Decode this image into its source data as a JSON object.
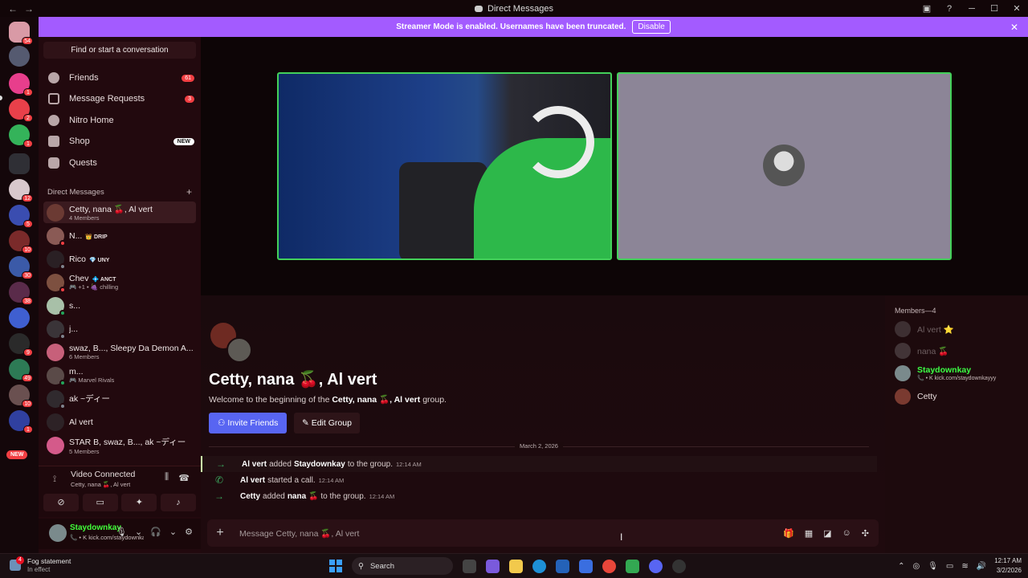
{
  "window": {
    "title": "Direct Messages",
    "back": "←",
    "forward": "→"
  },
  "banner": {
    "text": "Streamer Mode is enabled. Usernames have been truncated.",
    "button": "Disable"
  },
  "server_rail": {
    "badges": [
      "54",
      "1",
      "2",
      "1",
      "12",
      "5",
      "10",
      "30",
      "38",
      "9",
      "49",
      "10",
      "1"
    ],
    "new_label": "NEW"
  },
  "sidebar": {
    "search_placeholder": "Find or start a conversation",
    "nav": [
      {
        "label": "Friends",
        "count": "61"
      },
      {
        "label": "Message Requests",
        "count": "3"
      },
      {
        "label": "Nitro Home",
        "count": ""
      },
      {
        "label": "Shop",
        "tag": "NEW"
      },
      {
        "label": "Quests",
        "count": ""
      }
    ],
    "dm_header": "Direct Messages",
    "dms": [
      {
        "name": "Cetty, nana 🍒, Al vert",
        "sub": "4 Members"
      },
      {
        "name": "N...",
        "tag": "👑 DRIP",
        "sub": ""
      },
      {
        "name": "Rico",
        "tag": "💎 UNY",
        "sub": ""
      },
      {
        "name": "Chev",
        "tag": "💠 ANCT",
        "sub": "🎮 +1 • 🍇 chilling"
      },
      {
        "name": "s...",
        "sub": ""
      },
      {
        "name": "j...",
        "sub": ""
      },
      {
        "name": "swaz, B..., Sleepy Da Demon A...",
        "sub": "6 Members"
      },
      {
        "name": "m...",
        "sub": "🎮 Marvel Rivals"
      },
      {
        "name": "ak ~ディー",
        "sub": ""
      },
      {
        "name": "Al vert",
        "sub": ""
      },
      {
        "name": "STAR B, swaz, B..., ak ~ディー",
        "sub": "5 Members"
      }
    ]
  },
  "voice": {
    "status": "Video Connected",
    "channel": "Cetty, nana 🍒, Al vert"
  },
  "user": {
    "name": "Staydownkay",
    "status": "📞 • K kick.com/staydownkayyy"
  },
  "chat": {
    "group_title": "Cetty, nana 🍒, Al vert",
    "welcome_prefix": "Welcome to the beginning of the",
    "welcome_bold": "Cetty, nana 🍒, Al vert",
    "welcome_suffix": "group.",
    "invite": "Invite Friends",
    "edit": "Edit Group",
    "date_divider": "March 2, 2026",
    "messages": [
      {
        "actor": "Al vert",
        "verb": "added",
        "target": "Staydownkay",
        "rest": "to the group.",
        "time": "12:14 AM"
      },
      {
        "actor": "Al vert",
        "verb": "started a call.",
        "target": "",
        "rest": "",
        "time": "12:14 AM"
      },
      {
        "actor": "Cetty",
        "verb": "added",
        "target": "nana 🍒",
        "rest": "to the group.",
        "time": "12:14 AM"
      }
    ],
    "composer_placeholder": "Message Cetty, nana 🍒, Al vert"
  },
  "members": {
    "header": "Members—4",
    "list": [
      {
        "name": "Al vert ⭐",
        "sub": ""
      },
      {
        "name": "nana 🍒",
        "sub": ""
      },
      {
        "name": "Staydownkay",
        "sub": "📞 • K kick.com/staydownkayyy"
      },
      {
        "name": "Cetty",
        "sub": ""
      }
    ]
  },
  "taskbar": {
    "notif_title": "Fog statement",
    "notif_sub": "In effect",
    "notif_badge": "4",
    "search": "Search",
    "time": "12:17 AM",
    "date": "3/2/2026"
  },
  "colors": {
    "banner": "#a35bff",
    "accent": "#5865f2",
    "tile_border": "#43d15a",
    "badge": "#f23f43"
  }
}
